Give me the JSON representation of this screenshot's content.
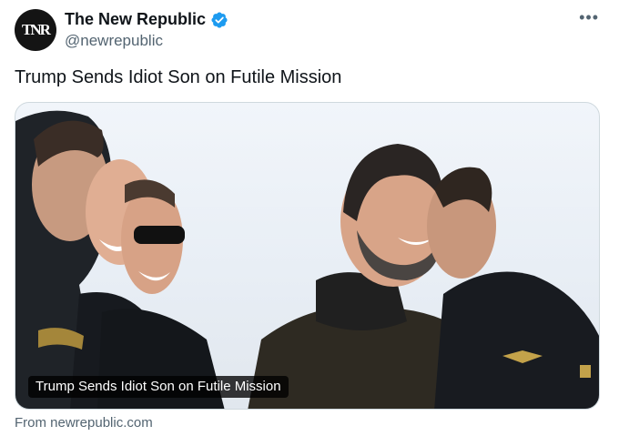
{
  "account": {
    "avatar_text": "TNR",
    "display_name": "The New Republic",
    "handle": "@newrepublic",
    "verified": "verified-badge-icon"
  },
  "menu": {
    "more_label": "•••"
  },
  "tweet": {
    "text": "Trump Sends Idiot Son on Futile Mission"
  },
  "card": {
    "image_alt": "Group of smiling men in dark jackets outdoors",
    "caption": "Trump Sends Idiot Son on Futile Mission",
    "source": "From newrepublic.com"
  },
  "colors": {
    "text_primary": "#0f1419",
    "text_secondary": "#536471",
    "verified_blue": "#1d9bf0",
    "border": "#cfd9de"
  }
}
